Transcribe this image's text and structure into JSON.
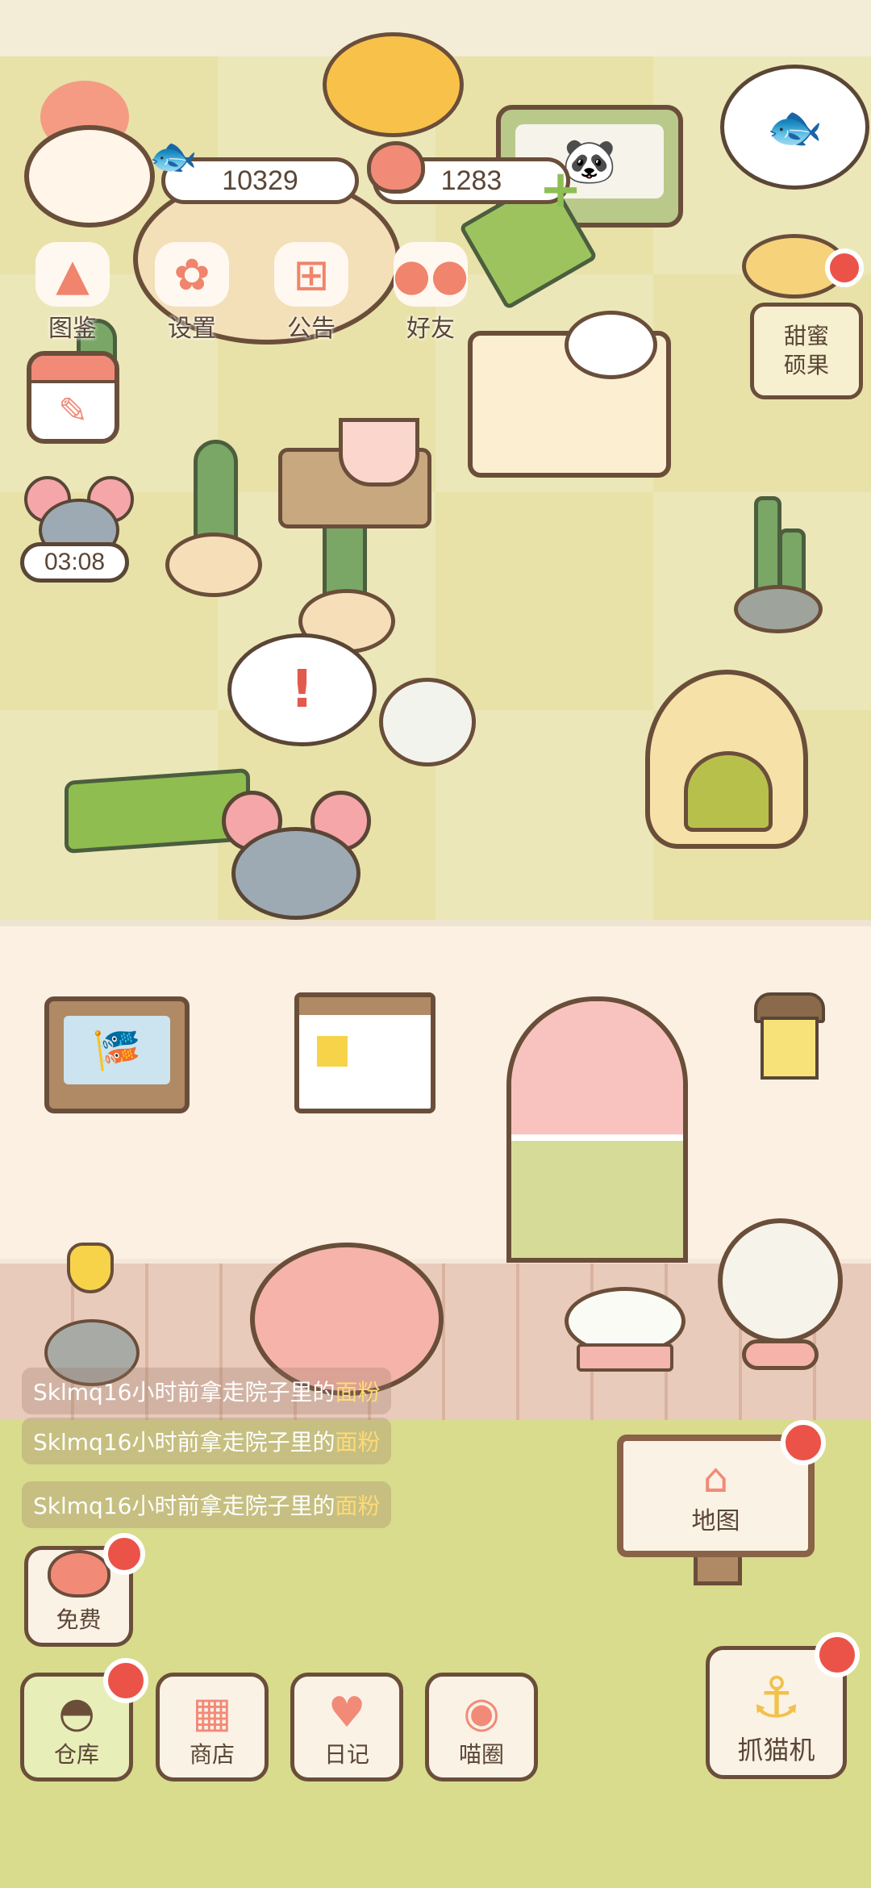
{
  "resources": {
    "fish_count": "10329",
    "heart_count": "1283"
  },
  "top_menu": [
    {
      "label": "图鉴",
      "icon": "cat-face-icon"
    },
    {
      "label": "设置",
      "icon": "gear-icon"
    },
    {
      "label": "公告",
      "icon": "gift-icon"
    },
    {
      "label": "好友",
      "icon": "friends-icon"
    }
  ],
  "timer": {
    "value": "03:08"
  },
  "shop_sign": {
    "label": "甜蜜\n硕果"
  },
  "activity_log": [
    {
      "text": "Sklmq16小时前拿走院子里的",
      "highlight": "面粉"
    },
    {
      "text": "Sklmq16小时前拿走院子里的",
      "highlight": "面粉"
    },
    {
      "text": "Sklmq16小时前拿走院子里的",
      "highlight": "面粉"
    }
  ],
  "map_button": {
    "label": "地图"
  },
  "free_button": {
    "label": "免费"
  },
  "bottom_nav": [
    {
      "label": "仓库",
      "icon": "warehouse-icon",
      "badge": true
    },
    {
      "label": "商店",
      "icon": "shop-icon",
      "badge": false
    },
    {
      "label": "日记",
      "icon": "diary-icon",
      "badge": false
    },
    {
      "label": "喵圈",
      "icon": "cat-planet-icon",
      "badge": false
    }
  ],
  "claw_button": {
    "label": "抓猫机"
  },
  "colors": {
    "badge": "#ec5348",
    "outline": "#6a4e3a",
    "highlight": "#ffd977",
    "yard": "#e8e2a8",
    "grass": "#d8dc8c"
  }
}
